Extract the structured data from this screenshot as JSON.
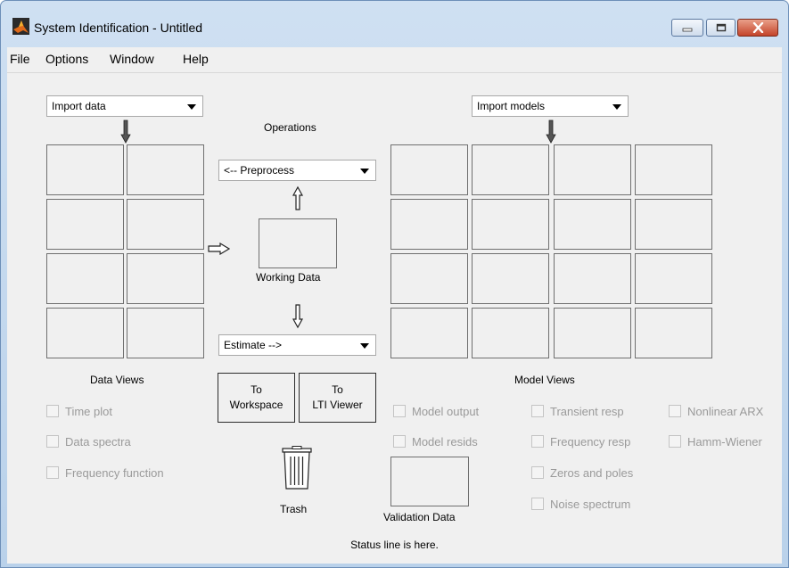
{
  "window": {
    "title": "System Identification - Untitled",
    "controls": {
      "minimize": "minimize",
      "maximize": "maximize",
      "close": "close"
    }
  },
  "menu": {
    "items": [
      {
        "label": "File"
      },
      {
        "label": "Options"
      },
      {
        "label": "Window"
      },
      {
        "label": "Help"
      }
    ]
  },
  "data_panel": {
    "import_dropdown": {
      "value": "Import data"
    },
    "views_label": "Data Views",
    "checkboxes": [
      {
        "label": "Time plot",
        "checked": false,
        "enabled": false
      },
      {
        "label": "Data spectra",
        "checked": false,
        "enabled": false
      },
      {
        "label": "Frequency function",
        "checked": false,
        "enabled": false
      }
    ]
  },
  "operations": {
    "label": "Operations",
    "preprocess_dropdown": {
      "value": "<-- Preprocess"
    },
    "working_data_label": "Working Data",
    "estimate_dropdown": {
      "value": "Estimate -->"
    },
    "to_workspace_button": {
      "line1": "To",
      "line2": "Workspace"
    },
    "to_lti_viewer_button": {
      "line1": "To",
      "line2": "LTI Viewer"
    },
    "trash_label": "Trash"
  },
  "model_panel": {
    "import_dropdown": {
      "value": "Import models"
    },
    "views_label": "Model Views",
    "validation_data_label": "Validation Data",
    "checkboxes": [
      {
        "label": "Model output",
        "checked": false,
        "enabled": false
      },
      {
        "label": "Model resids",
        "checked": false,
        "enabled": false
      },
      {
        "label": "Transient resp",
        "checked": false,
        "enabled": false
      },
      {
        "label": "Frequency resp",
        "checked": false,
        "enabled": false
      },
      {
        "label": "Zeros and poles",
        "checked": false,
        "enabled": false
      },
      {
        "label": "Noise spectrum",
        "checked": false,
        "enabled": false
      },
      {
        "label": "Nonlinear ARX",
        "checked": false,
        "enabled": false
      },
      {
        "label": "Hamm-Wiener",
        "checked": false,
        "enabled": false
      }
    ]
  },
  "status": {
    "text": "Status line is here."
  },
  "colors": {
    "title_gradient_top": "#cfe0f2",
    "title_gradient_bottom": "#b9d1ea",
    "panel_background": "#f0f0f0",
    "close_button": "#c4442a",
    "disabled_text": "#9a9a9a"
  }
}
